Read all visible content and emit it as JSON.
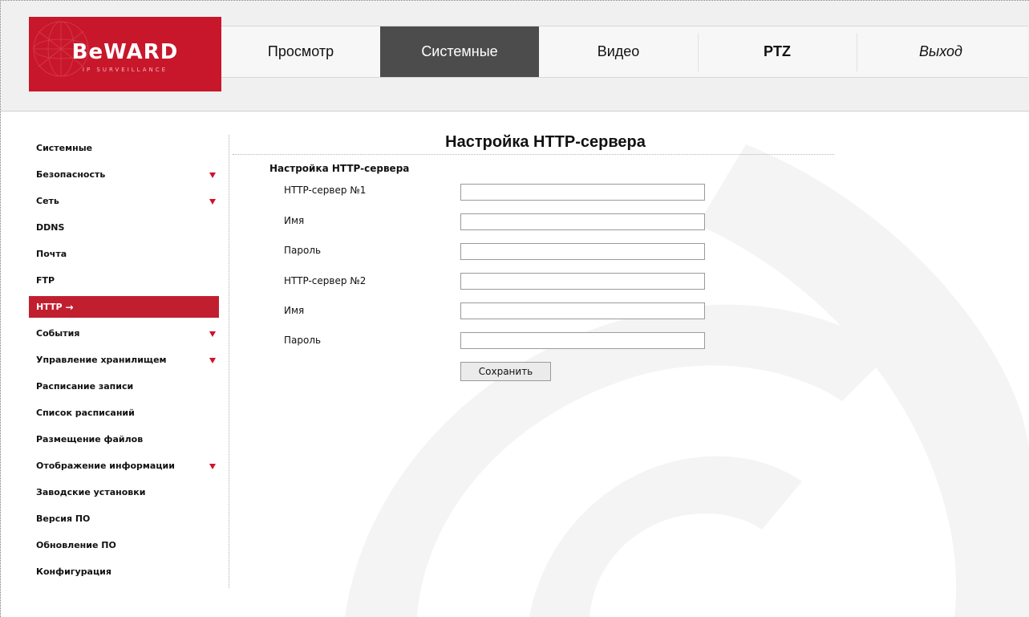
{
  "logo": {
    "brand": "BeWARD",
    "subtitle": "IP SURVEILLANCE",
    "color": "#c8172b"
  },
  "topnav": {
    "tabs": [
      {
        "label": "Просмотр",
        "active": false
      },
      {
        "label": "Системные",
        "active": true
      },
      {
        "label": "Видео",
        "active": false
      },
      {
        "label": "PTZ",
        "active": false
      },
      {
        "label": "Выход",
        "active": false
      }
    ]
  },
  "sidebar": {
    "items": [
      {
        "label": "Системные",
        "has_submenu": false
      },
      {
        "label": "Безопасность",
        "has_submenu": true
      },
      {
        "label": "Сеть",
        "has_submenu": true
      },
      {
        "label": "DDNS",
        "has_submenu": false
      },
      {
        "label": "Почта",
        "has_submenu": false
      },
      {
        "label": "FTP",
        "has_submenu": false
      },
      {
        "label": "HTTP",
        "active_marker": "→",
        "active": true
      },
      {
        "label": "События",
        "has_submenu": true
      },
      {
        "label": "Управление хранилищем",
        "has_submenu": true
      },
      {
        "label": "Расписание записи",
        "has_submenu": false
      },
      {
        "label": "Список расписаний",
        "has_submenu": false
      },
      {
        "label": "Размещение файлов",
        "has_submenu": false
      },
      {
        "label": "Отображение информации",
        "has_submenu": true
      },
      {
        "label": "Заводские установки",
        "has_submenu": false
      },
      {
        "label": "Версия ПО",
        "has_submenu": false
      },
      {
        "label": "Обновление ПО",
        "has_submenu": false
      },
      {
        "label": "Конфигурация",
        "has_submenu": false
      }
    ],
    "active_color": "#c11f30",
    "submenu_arrow_color": "#d0112b"
  },
  "main": {
    "page_title": "Настройка HTTP-сервера",
    "section_title": "Настройка HTTP-сервера",
    "fields": [
      {
        "label": "HTTP-сервер №1",
        "value": ""
      },
      {
        "label": "Имя",
        "value": ""
      },
      {
        "label": "Пароль",
        "value": ""
      },
      {
        "label": "HTTP-сервер №2",
        "value": ""
      },
      {
        "label": "Имя",
        "value": ""
      },
      {
        "label": "Пароль",
        "value": ""
      }
    ],
    "save_label": "Сохранить"
  }
}
